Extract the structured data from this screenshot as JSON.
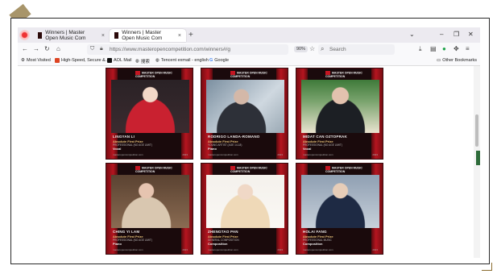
{
  "tabs": [
    {
      "title": "Winners | Master Open Music Com"
    },
    {
      "title": "Winners | Master Open Music Com"
    }
  ],
  "toolbar": {
    "url": "https://www.masteropencompetition.com/winners#/g",
    "zoom": "90%",
    "search_placeholder": "Search"
  },
  "bookmarks": [
    {
      "label": "Most Visited"
    },
    {
      "label": "High-Speed, Secure &..."
    },
    {
      "label": "AOL Mail"
    },
    {
      "label": "搜索"
    },
    {
      "label": "Tencent exmail - english"
    },
    {
      "label": "Google"
    }
  ],
  "other_bookmarks": "Other Bookmarks",
  "cards": [
    {
      "name": "LINGYAN LI",
      "award": "Absolute First Prize",
      "category": "PROFESSIONAL (NO AGE LIMIT)",
      "instrument": "Vocal",
      "site": "masteropencompetition.com",
      "year": "2023"
    },
    {
      "name": "RODRIGO LANDA-ROMANO",
      "award": "Absolute First Prize",
      "category": "YOUNG ARTIST (AGE 14-18)",
      "instrument": "Piano",
      "site": "masteropencompetition.com",
      "year": "2023"
    },
    {
      "name": "MIDAT CAN OZTOPRAK",
      "award": "Absolute First Prize",
      "category": "PROFESSIONAL (NO AGE LIMIT)",
      "instrument": "Vocal",
      "site": "masteropencompetition.com",
      "year": "2023"
    },
    {
      "name": "CHING YI LAM",
      "award": "Absolute First Prize",
      "category": "PROFESSIONAL (NO AGE LIMIT)",
      "instrument": "Piano",
      "site": "masteropencompetition.com",
      "year": "2023"
    },
    {
      "name": "ZHENGTAO PAN",
      "award": "Absolute First Prize",
      "category": "GENERAL COMPOSITION",
      "instrument": "Composition",
      "site": "masteropencompetition.com",
      "year": "2023"
    },
    {
      "name": "HOLAI FANG",
      "award": "Absolute First Prize",
      "category": "PROFESSIONAL MUSIC",
      "instrument": "Composition",
      "site": "masteropencompetition.com",
      "year": "2023"
    }
  ],
  "logo_text": "MASTER OPEN MUSIC COMPETITION"
}
